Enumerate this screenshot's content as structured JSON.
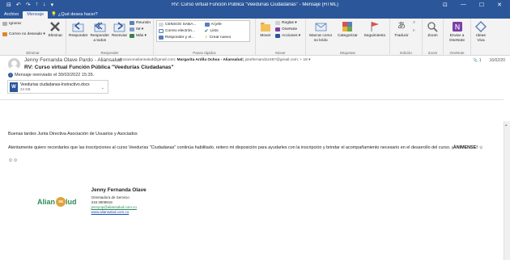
{
  "window": {
    "title": "RV: Curso virtual Función Pública \"Veedurías Ciudadanas\" - Mensaje (HTML)",
    "quick_access": [
      "⊟",
      "↶",
      "↷",
      "↑",
      "↓",
      "▾"
    ],
    "controls": [
      "⊡",
      "—",
      "☐",
      "✕"
    ]
  },
  "tabs": {
    "items": [
      "Archivo",
      "Mensaje"
    ],
    "tell_me": "¿Qué desea hacer?"
  },
  "ribbon": {
    "delete_group": {
      "ignore": "Ignorar",
      "junk": "Correo no deseado ▾",
      "delete": "Eliminar",
      "label": "Eliminar"
    },
    "respond_group": {
      "reply": "Responder",
      "reply_all": "Responder a todos",
      "forward": "Reenviar",
      "meeting": "Reunión",
      "im": "IM ▾",
      "more": "Más ▾",
      "label": "Responder"
    },
    "quick_steps": {
      "items": [
        "CENSOS SABA...",
        "Al jefe",
        "Correo electrón...",
        "Listo",
        "Responder y el...",
        "Crear nuevo"
      ],
      "label": "Pasos rápidos"
    },
    "move_group": {
      "move": "Mover",
      "rules": "Reglas ▾",
      "onenote": "OneNote",
      "actions": "Acciones ▾",
      "label": "Mover"
    },
    "tags_group": {
      "mark_unread": "Marcar como no leído",
      "categorize": "Categorizar",
      "followup": "Seguimiento",
      "label": "Etiquetas"
    },
    "editing_group": {
      "translate": "Traducir",
      "label": "Edición"
    },
    "zoom_group": {
      "zoom": "Zoom",
      "label": "Zoom"
    },
    "onenote_group": {
      "send": "Enviar a OneNote",
      "label": "OneNote"
    },
    "viva_group": {
      "viva": "Ideas Viva"
    }
  },
  "message": {
    "sender": "Jenny Fernanda Olave Pardo - Aliansalud",
    "recipients_prefix": "asociacionaliansalud@gmail.com;",
    "recipients_bold": "Margarita Ardila Ochoa - Aliansalud;",
    "recipients_suffix": "josefernando2467@gmail.com;  + 18 ▾",
    "subject": "RV: Curso virtual Función Pública \"Veedurías Ciudadanas\"",
    "attachment_count": "1",
    "date": "16/02/20",
    "forward_note": "Mensaje reenviado el 30/03/2022 15:35.",
    "attachment": {
      "name": "Veedurias ciudadanas-Instructivo.docx",
      "size": "24 KB"
    }
  },
  "body": {
    "greeting": "Buenas tardes  Junta Directiva Asociación de Usuarios y Asociados",
    "paragraph": "Atentamente quiero recordarles que las inscripciones al curso Veedurías \"Ciudadanas\" continúa habilitado, reitero mi disposición para ayudarles con la inscripción y brindar el acompañamiento necesario en el desarrollo del curso.",
    "paragraph_bold": "¡ÁNIMENSE!",
    "emojis": "☺☺"
  },
  "signature": {
    "logo_text_a": "Alian",
    "logo_text_b": "lud",
    "logo_badge": "sa",
    "name": "Jenny Fernanda Olave",
    "role": "Orientadora de Servicio",
    "phone": "318.3808818",
    "email": "jennyop@aliansalud.com.co",
    "web": "www.aliansalud.com.co"
  },
  "colors": {
    "accent": "#2b579a",
    "ribbon_bg": "#f3f3f3",
    "logo_green": "#2e8b57",
    "logo_orange": "#e2a23b"
  }
}
